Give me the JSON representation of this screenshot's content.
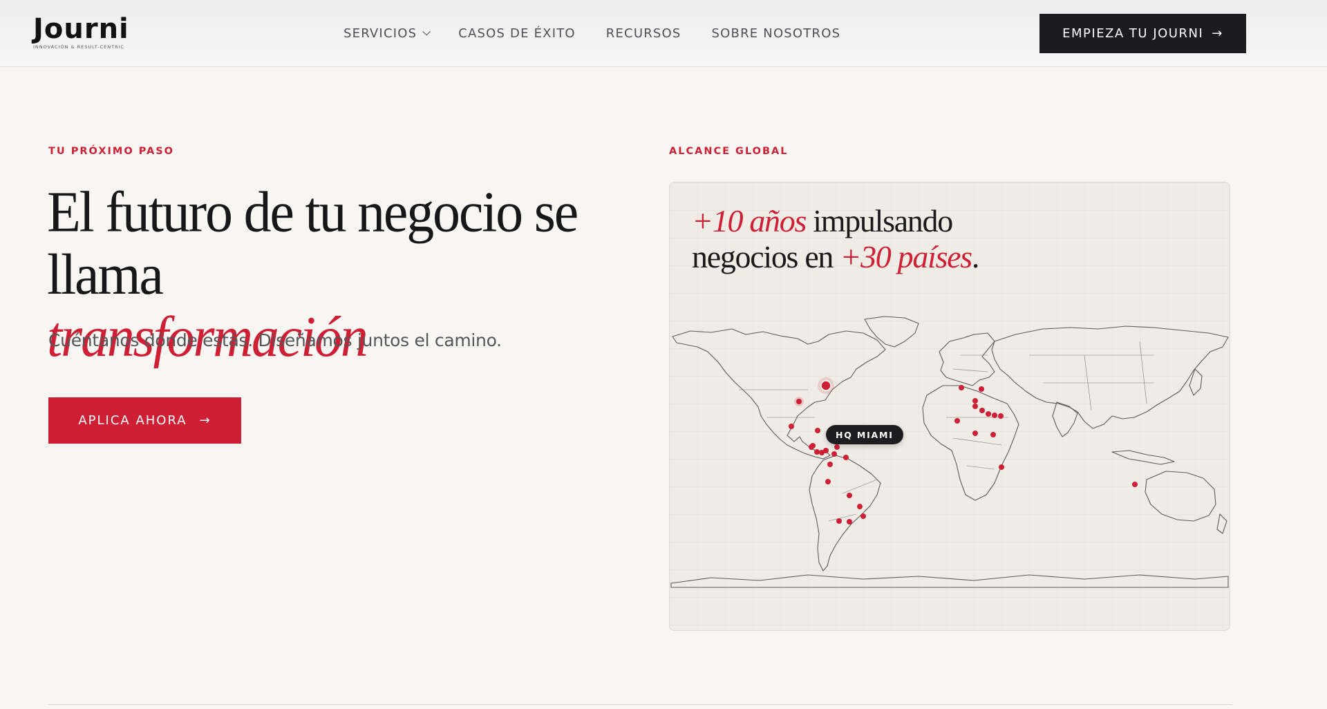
{
  "brand": {
    "name": "Journi",
    "tagline": "INNOVACIÓN & RESULT-CENTRIC"
  },
  "nav": {
    "items": [
      {
        "label": "SERVICIOS",
        "has_dropdown": true
      },
      {
        "label": "CASOS DE ÉXITO"
      },
      {
        "label": "RECURSOS"
      },
      {
        "label": "SOBRE NOSOTROS"
      }
    ],
    "cta_label": "EMPIEZA TU JOURNI",
    "cta_icon": "arrow-right-icon"
  },
  "hero": {
    "eyebrow": "TU PRÓXIMO PASO",
    "headline": "El futuro de tu negocio se llama",
    "headline_accent": "transformación",
    "subtitle": "Cuéntanos dónde estás. Diseñamos juntos el camino.",
    "cta_label": "APLICA AHORA",
    "cta_icon": "arrow-right-icon"
  },
  "reach": {
    "eyebrow": "ALCANCE GLOBAL",
    "years": "+10 años",
    "title_mid": " impulsando",
    "title_line2": "negocios en ",
    "countries": "+30 países",
    "title_end": ".",
    "hq_label": "HQ MIAMI"
  },
  "colors": {
    "accent": "#cf1f34",
    "dark": "#1c1c20",
    "background": "#f8f6f3",
    "card": "#efebe5"
  }
}
